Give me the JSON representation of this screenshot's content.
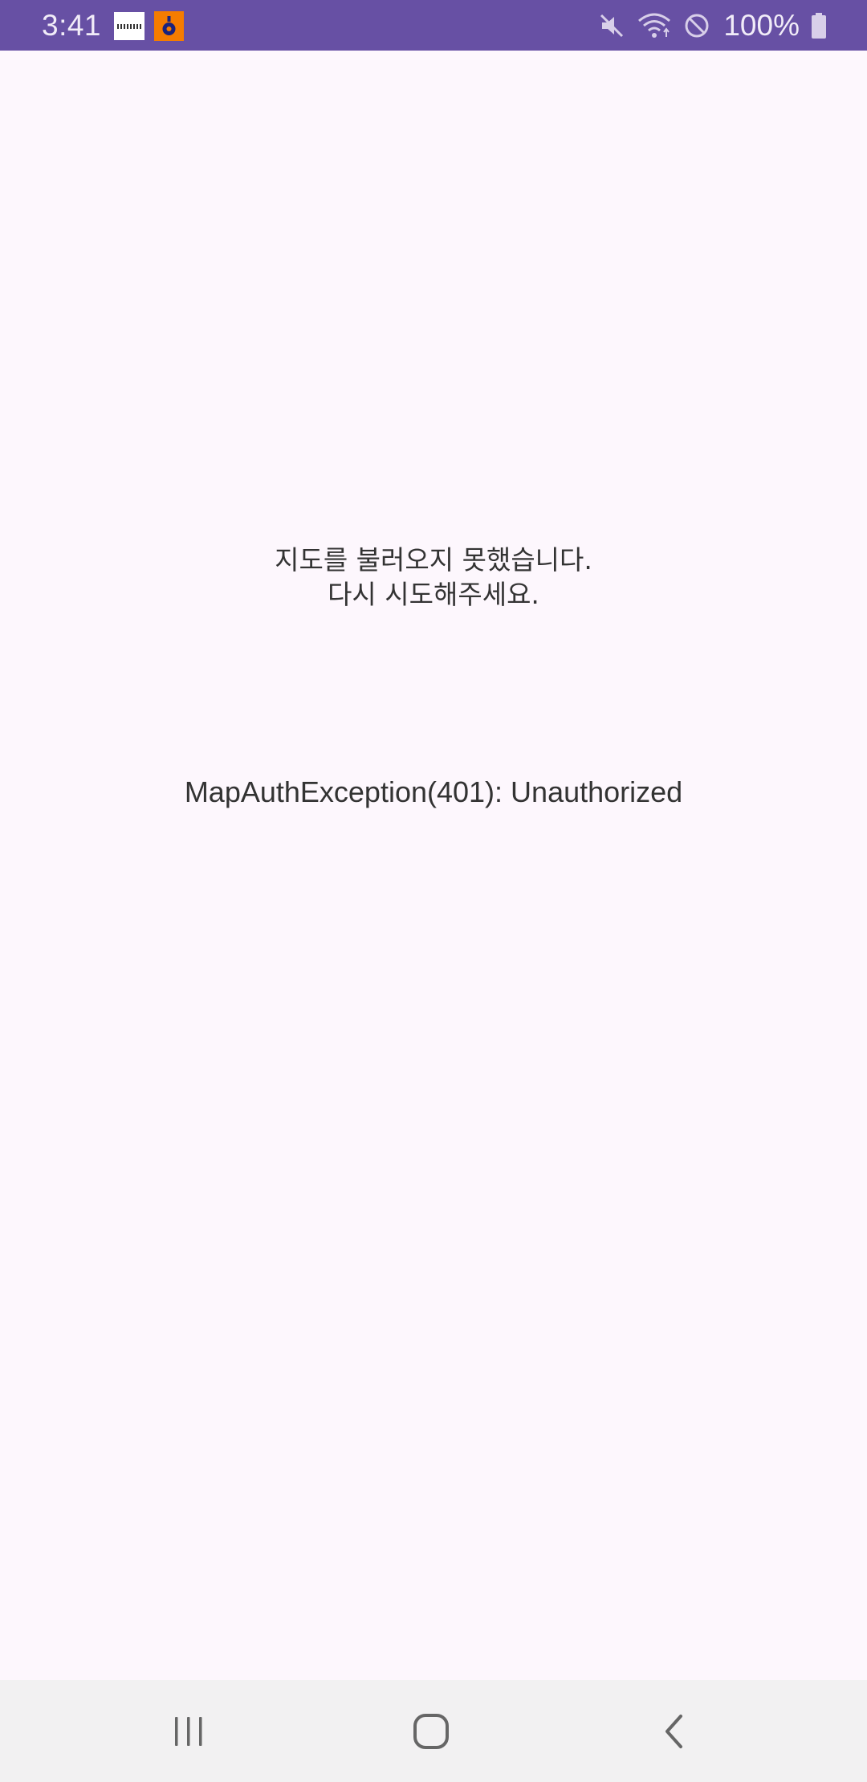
{
  "status_bar": {
    "time": "3:41",
    "battery": "100%",
    "icons": [
      "notification-app-icon",
      "notification-app-icon-orange",
      "mute-icon",
      "wifi-icon",
      "do-not-disturb-icon",
      "battery-icon"
    ],
    "background": "#6750a4"
  },
  "main": {
    "error_line_1": "지도를 불러오지 못했습니다.",
    "error_line_2": "다시 시도해주세요.",
    "exception": "MapAuthException(401): Unauthorized"
  },
  "nav_bar": {
    "icons": [
      "recent-apps-icon",
      "home-icon",
      "back-icon"
    ]
  }
}
